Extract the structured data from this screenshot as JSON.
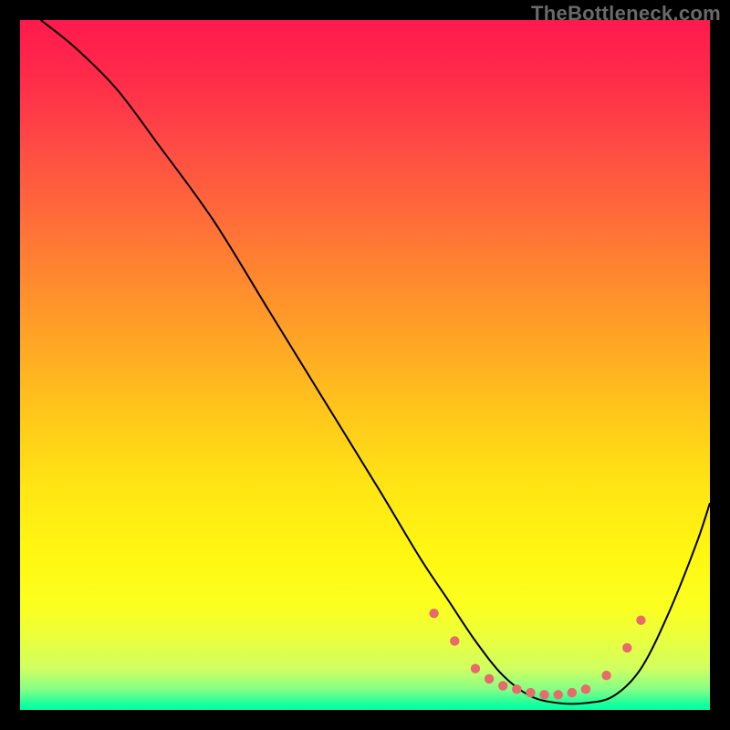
{
  "watermark": "TheBottleneck.com",
  "chart_data": {
    "type": "line",
    "title": "",
    "xlabel": "",
    "ylabel": "",
    "xlim": [
      0,
      100
    ],
    "ylim": [
      0,
      100
    ],
    "grid": false,
    "legend": false,
    "series": [
      {
        "name": "bottleneck-curve",
        "x": [
          3,
          8,
          14,
          20,
          28,
          36,
          44,
          52,
          58,
          62,
          66,
          70,
          74,
          78,
          82,
          86,
          90,
          94,
          98,
          100
        ],
        "y": [
          100,
          96,
          90,
          82,
          71,
          58,
          45,
          32,
          22,
          16,
          10,
          5,
          2,
          1,
          1,
          2,
          6,
          14,
          24,
          30
        ]
      }
    ],
    "markers": {
      "name": "optimal-zone-beads",
      "points": [
        {
          "x": 60,
          "y": 14
        },
        {
          "x": 63,
          "y": 10
        },
        {
          "x": 66,
          "y": 6
        },
        {
          "x": 68,
          "y": 4.5
        },
        {
          "x": 70,
          "y": 3.5
        },
        {
          "x": 72,
          "y": 3
        },
        {
          "x": 74,
          "y": 2.5
        },
        {
          "x": 76,
          "y": 2.2
        },
        {
          "x": 78,
          "y": 2.2
        },
        {
          "x": 80,
          "y": 2.5
        },
        {
          "x": 82,
          "y": 3
        },
        {
          "x": 85,
          "y": 5
        },
        {
          "x": 88,
          "y": 9
        },
        {
          "x": 90,
          "y": 13
        }
      ]
    },
    "gradient_stops": [
      {
        "pos": 0,
        "color": "#ff1a4d"
      },
      {
        "pos": 50,
        "color": "#ffca1a"
      },
      {
        "pos": 85,
        "color": "#fbff20"
      },
      {
        "pos": 100,
        "color": "#00ffa8"
      }
    ]
  }
}
